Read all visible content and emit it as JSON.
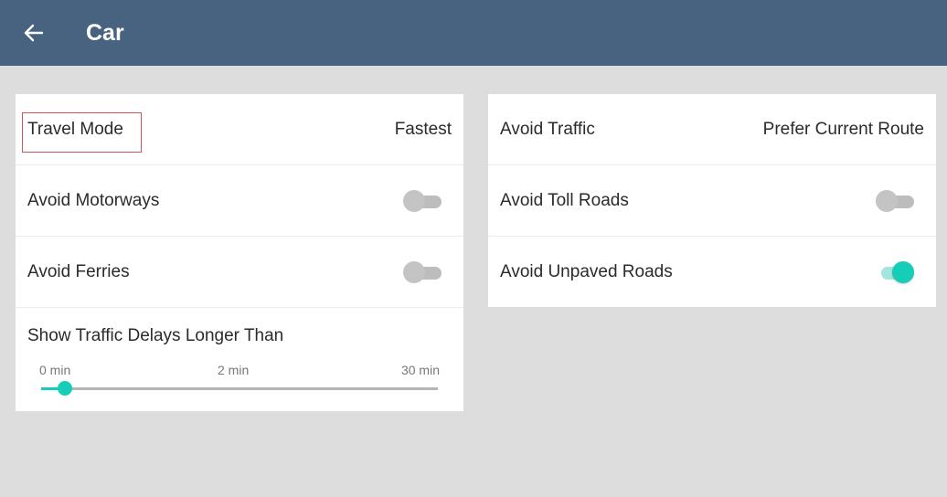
{
  "header": {
    "title": "Car",
    "background": "#47637f"
  },
  "left_card": {
    "travel_mode": {
      "label": "Travel Mode",
      "value": "Fastest"
    },
    "avoid_motorways": {
      "label": "Avoid Motorways",
      "enabled": false
    },
    "avoid_ferries": {
      "label": "Avoid Ferries",
      "enabled": false
    },
    "traffic_delay": {
      "label": "Show Traffic Delays Longer Than",
      "ticks": [
        "0 min",
        "2 min",
        "30 min"
      ],
      "value_fraction": 0.06
    }
  },
  "right_card": {
    "avoid_traffic": {
      "label": "Avoid Traffic",
      "value": "Prefer Current Route"
    },
    "avoid_toll_roads": {
      "label": "Avoid Toll Roads",
      "enabled": false
    },
    "avoid_unpaved_roads": {
      "label": "Avoid Unpaved Roads",
      "enabled": true
    }
  },
  "colors": {
    "accent": "#16cdb8",
    "highlight_border": "#d0555a",
    "background": "#dddddd"
  },
  "icons": {
    "back": "arrow-left-icon"
  }
}
